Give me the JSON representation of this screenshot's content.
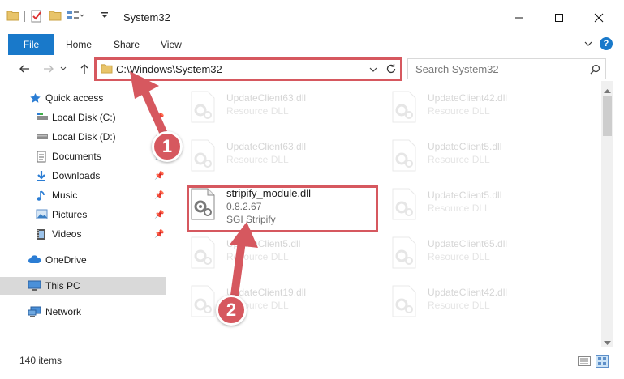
{
  "window": {
    "title": "System32"
  },
  "ribbon": {
    "tabs": [
      "File",
      "Home",
      "Share",
      "View"
    ]
  },
  "address": {
    "path": "C:\\Windows\\System32",
    "search_placeholder": "Search System32"
  },
  "sidebar": {
    "items": [
      {
        "label": "Quick access",
        "icon": "star-icon",
        "pinned": false
      },
      {
        "label": "Local Disk (C:)",
        "icon": "drive-icon",
        "pinned": true
      },
      {
        "label": "Local Disk (D:)",
        "icon": "drive-icon",
        "pinned": true
      },
      {
        "label": "Documents",
        "icon": "documents-icon",
        "pinned": true
      },
      {
        "label": "Downloads",
        "icon": "download-icon",
        "pinned": true
      },
      {
        "label": "Music",
        "icon": "music-icon",
        "pinned": true
      },
      {
        "label": "Pictures",
        "icon": "pictures-icon",
        "pinned": true
      },
      {
        "label": "Videos",
        "icon": "videos-icon",
        "pinned": true
      },
      {
        "label": "OneDrive",
        "icon": "cloud-icon",
        "pinned": false
      },
      {
        "label": "This PC",
        "icon": "computer-icon",
        "pinned": false,
        "selected": true
      },
      {
        "label": "Network",
        "icon": "network-icon",
        "pinned": false
      }
    ]
  },
  "files": {
    "left_column": [
      {
        "name": "UpdateClient63.dll",
        "type": "Resource DLL",
        "faded": true
      },
      {
        "name": "UpdateClient63.dll",
        "type": "Resource DLL",
        "faded": true
      },
      {
        "name": "stripify_module.dll",
        "version": "0.8.2.67",
        "company": "SGI Stripify",
        "faded": false
      },
      {
        "name": "UpdateClient5.dll",
        "type": "Resource DLL",
        "faded": true
      },
      {
        "name": "UpdateClient19.dll",
        "type": "Resource DLL",
        "faded": true
      }
    ],
    "right_column": [
      {
        "name": "UpdateClient42.dll",
        "type": "Resource DLL",
        "faded": true
      },
      {
        "name": "UpdateClient5.dll",
        "type": "Resource DLL",
        "faded": true
      },
      {
        "name": "UpdateClient5.dll",
        "type": "Resource DLL",
        "faded": true
      },
      {
        "name": "UpdateClient65.dll",
        "type": "Resource DLL",
        "faded": true
      },
      {
        "name": "UpdateClient42.dll",
        "type": "Resource DLL",
        "faded": true
      }
    ]
  },
  "status": {
    "item_count": "140 items"
  },
  "annotations": {
    "step1": "1",
    "step2": "2",
    "color": "#d6585f"
  },
  "colors": {
    "accent": "#1979ca",
    "highlight": "#d6585f"
  }
}
